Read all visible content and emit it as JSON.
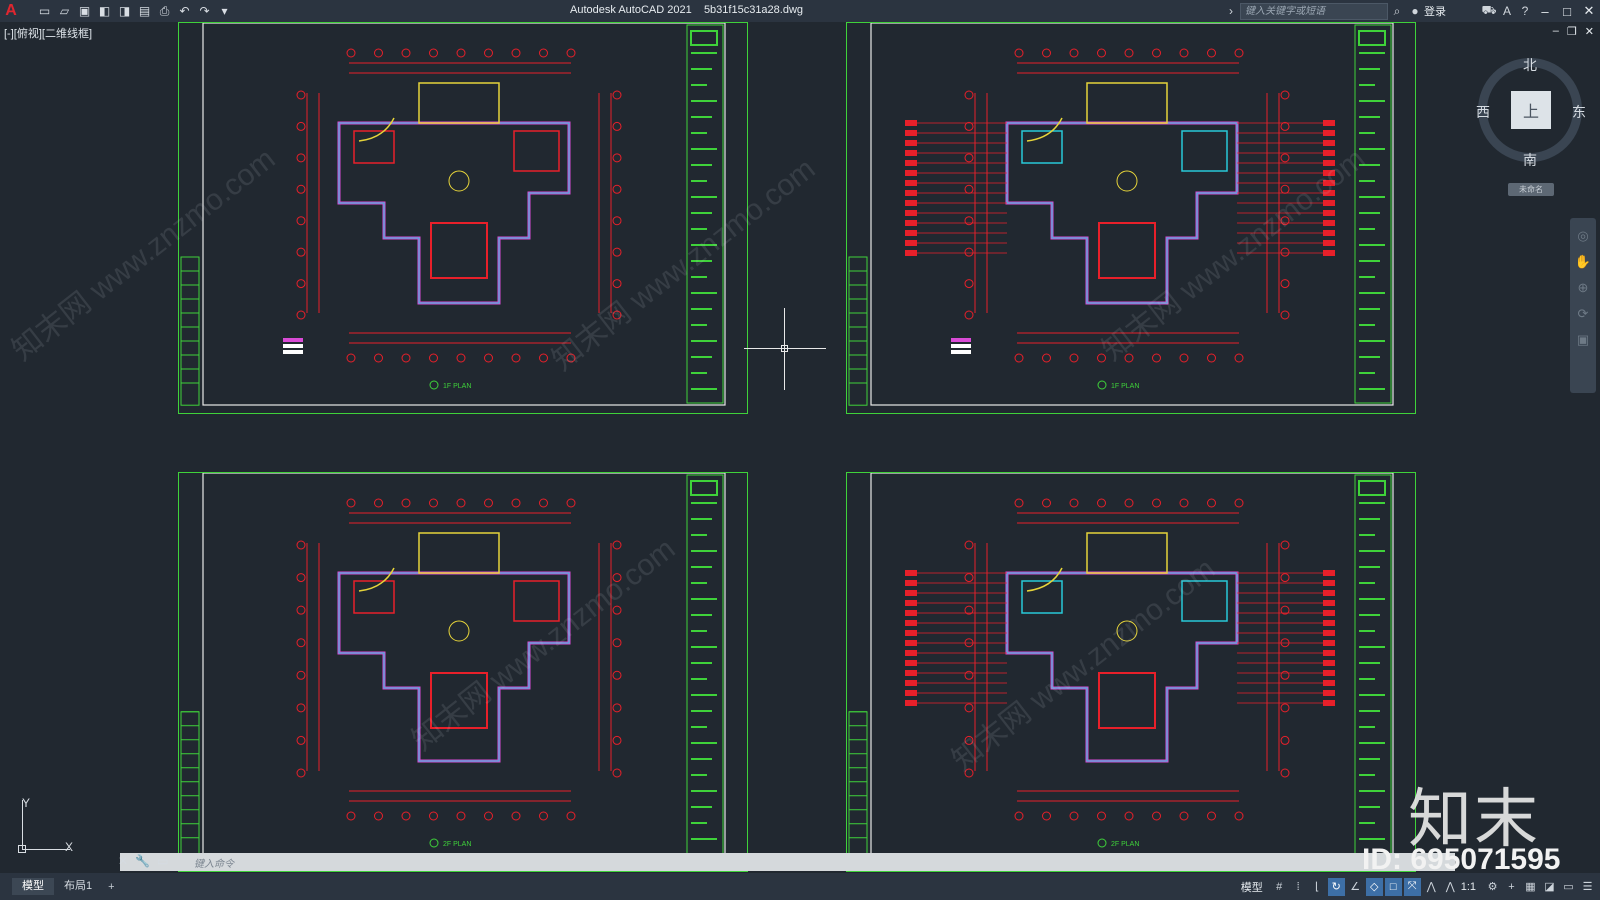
{
  "titlebar": {
    "app_title": "Autodesk AutoCAD 2021",
    "file_name": "5b31f15c31a28.dwg",
    "search_placeholder": "键入关键字或短语",
    "login_label": "登录"
  },
  "viewport": {
    "label": "[-][俯视][二维线框]"
  },
  "viewcube": {
    "north": "北",
    "south": "南",
    "east": "东",
    "west": "西",
    "face": "上",
    "wcs": "未命名"
  },
  "ucs": {
    "x": "X",
    "y": "Y"
  },
  "command": {
    "placeholder": "键入命令"
  },
  "layout_tabs": [
    {
      "label": "模型"
    },
    {
      "label": "布局1"
    }
  ],
  "add_tab": "+",
  "status": {
    "model_label": "模型",
    "scale_label": "1:1"
  },
  "watermark": {
    "logo": "知末",
    "id": "ID: 695071595",
    "site": "知末网 www.znzmo.com"
  },
  "sheets": [
    {
      "plan_title": "1F PLAN"
    },
    {
      "plan_title": "1F PLAN"
    },
    {
      "plan_title": "2F PLAN"
    },
    {
      "plan_title": "2F PLAN"
    }
  ],
  "colors": {
    "frame_green": "#3fd23a",
    "line_red": "#e8202a",
    "wall_magenta": "#d94bd6",
    "cyan": "#28c9d8",
    "yellow": "#e6d43a",
    "background": "#212830"
  }
}
